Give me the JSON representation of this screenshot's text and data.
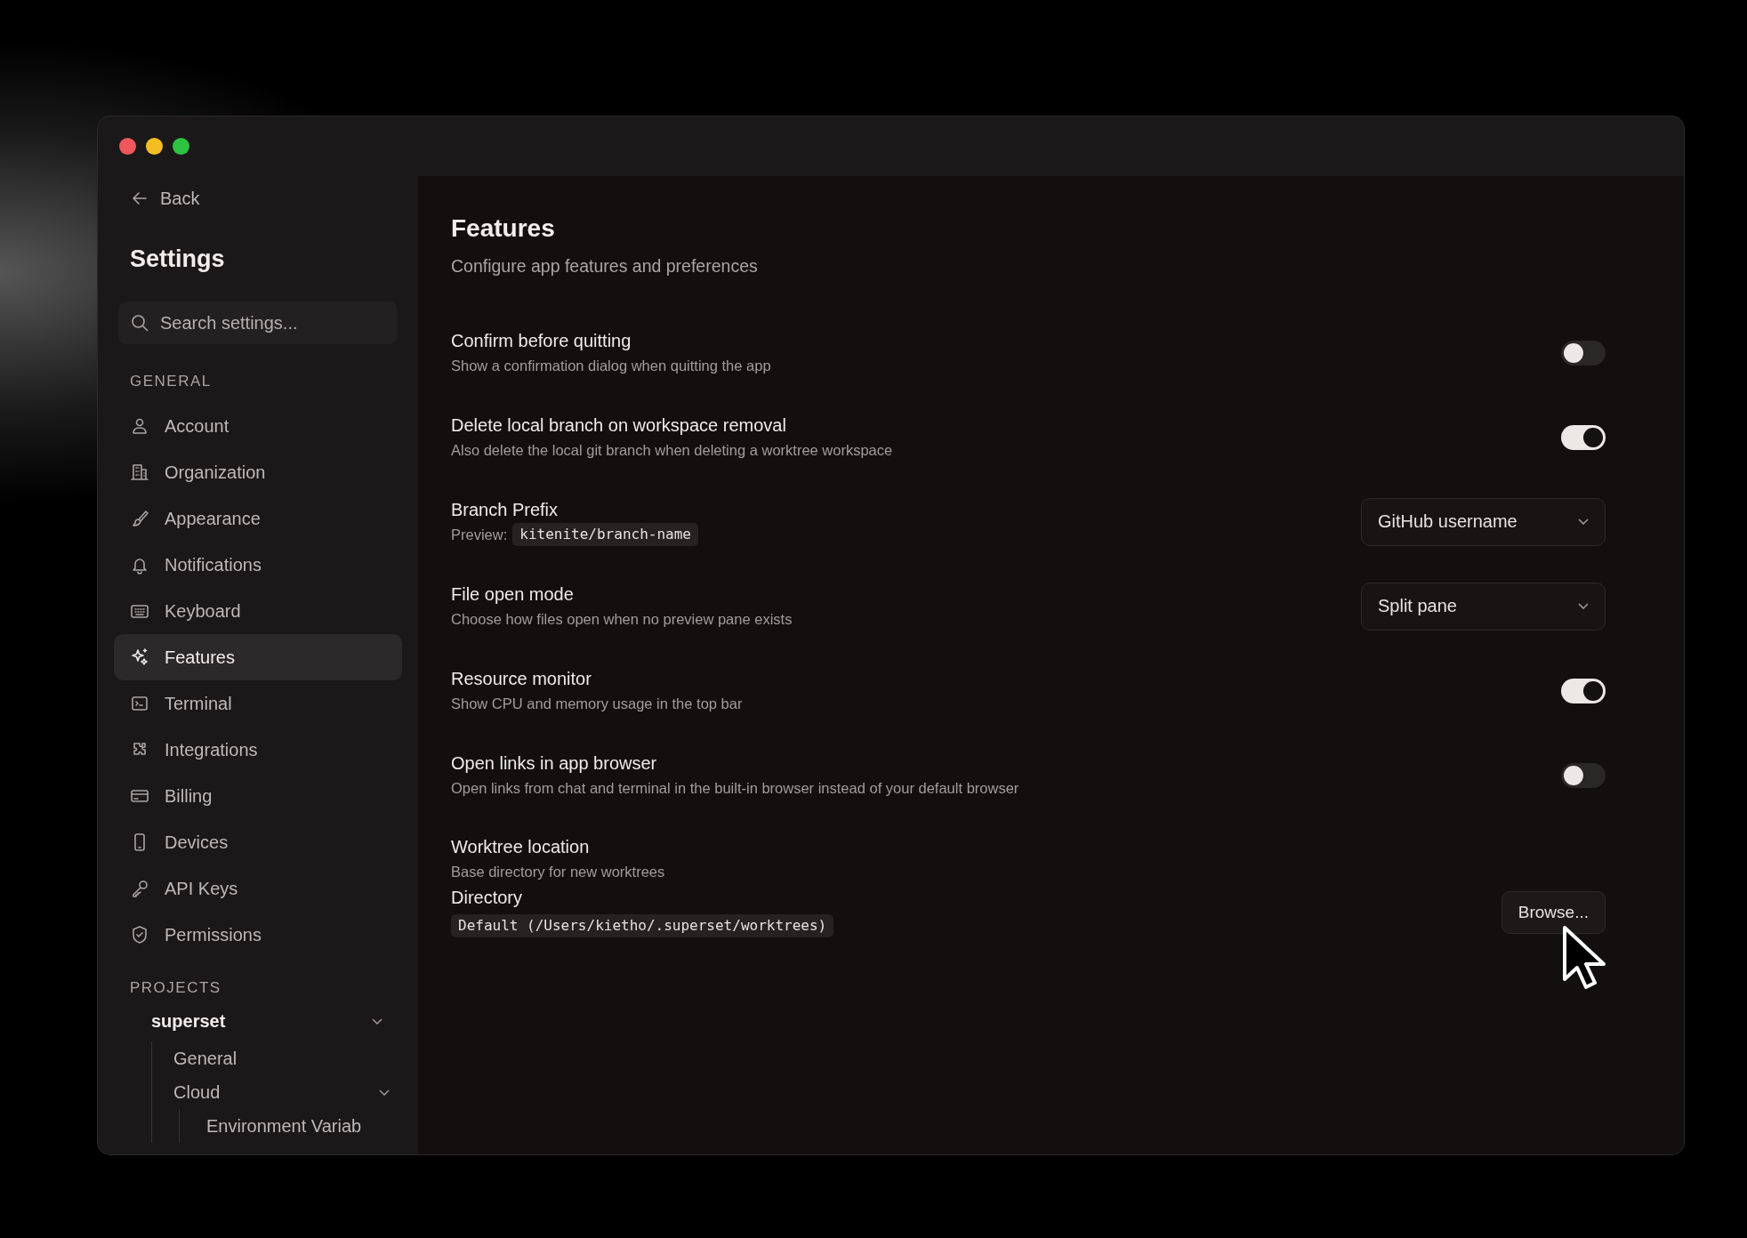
{
  "sidebar": {
    "back": "Back",
    "title": "Settings",
    "search": {
      "placeholder": "Search settings..."
    },
    "general": {
      "heading": "GENERAL",
      "items": [
        {
          "label": "Account",
          "selected": false
        },
        {
          "label": "Organization",
          "selected": false
        },
        {
          "label": "Appearance",
          "selected": false
        },
        {
          "label": "Notifications",
          "selected": false
        },
        {
          "label": "Keyboard",
          "selected": false
        },
        {
          "label": "Features",
          "selected": true
        },
        {
          "label": "Terminal",
          "selected": false
        },
        {
          "label": "Integrations",
          "selected": false
        },
        {
          "label": "Billing",
          "selected": false
        },
        {
          "label": "Devices",
          "selected": false
        },
        {
          "label": "API Keys",
          "selected": false
        },
        {
          "label": "Permissions",
          "selected": false
        }
      ]
    },
    "projects": {
      "heading": "PROJECTS",
      "items": [
        {
          "label": "superset",
          "expanded": true,
          "children": [
            {
              "label": "General"
            },
            {
              "label": "Cloud",
              "expanded": true,
              "children": [
                {
                  "label": "Environment Variab"
                }
              ]
            }
          ]
        }
      ]
    }
  },
  "main": {
    "title": "Features",
    "subtitle": "Configure app features and preferences",
    "settings": [
      {
        "kind": "toggle",
        "title": "Confirm before quitting",
        "description": "Show a confirmation dialog when quitting the app",
        "on": false
      },
      {
        "kind": "toggle",
        "title": "Delete local branch on workspace removal",
        "description": "Also delete the local git branch when deleting a worktree workspace",
        "on": true
      },
      {
        "kind": "select",
        "title": "Branch Prefix",
        "preview_label": "Preview:",
        "preview": "kitenite/branch-name",
        "value": "GitHub username"
      },
      {
        "kind": "select",
        "title": "File open mode",
        "description": "Choose how files open when no preview pane exists",
        "value": "Split pane"
      },
      {
        "kind": "toggle",
        "title": "Resource monitor",
        "description": "Show CPU and memory usage in the top bar",
        "on": true
      },
      {
        "kind": "toggle",
        "title": "Open links in app browser",
        "description": "Open links from chat and terminal in the built-in browser instead of your default browser",
        "on": false
      },
      {
        "kind": "directory",
        "title": "Worktree location",
        "description": "Base directory for new worktrees",
        "field_label": "Directory",
        "path": "Default (/Users/kietho/.superset/worktrees)",
        "button": "Browse..."
      }
    ]
  }
}
